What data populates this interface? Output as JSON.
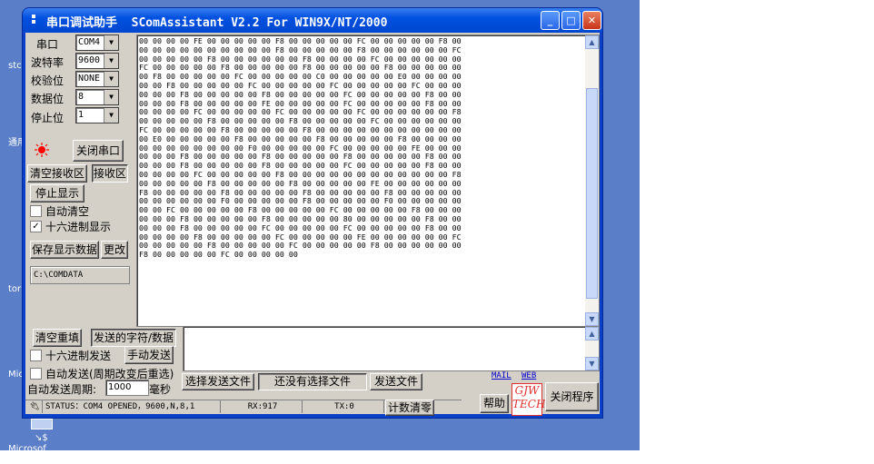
{
  "desktop": {
    "labels": [
      "stc",
      "通用",
      "tor",
      "Mic",
      "Microsof"
    ]
  },
  "window": {
    "title": "串口调试助手  SComAssistant V2.2 For WIN9X/NT/2000",
    "minimize": "_",
    "maximize": "□",
    "close": "✕"
  },
  "settings": {
    "port_label": "串口",
    "port_value": "COM4",
    "baud_label": "波特率",
    "baud_value": "9600",
    "parity_label": "校验位",
    "parity_value": "NONE",
    "databits_label": "数据位",
    "databits_value": "8",
    "stopbits_label": "停止位",
    "stopbits_value": "1"
  },
  "controls": {
    "close_port": "关闭串口",
    "clear_recv": "清空接收区",
    "recv_area": "接收区",
    "stop_display": "停止显示",
    "auto_clear": "自动清空",
    "hex_display": "十六进制显示",
    "save_display": "保存显示数据",
    "change": "更改",
    "path": "C:\\COMDATA",
    "clear_refill": "清空重填",
    "send_chars": "发送的字符/数据",
    "hex_send": "十六进制发送",
    "manual_send": "手动发送",
    "auto_send": "自动发送(周期改变后重选)",
    "auto_period_label": "自动发送周期:",
    "auto_period_value": "1000",
    "ms_label": "毫秒",
    "select_file": "选择发送文件",
    "no_file": "还没有选择文件",
    "send_file": "发送文件",
    "mail": "MAIL",
    "web": "WEB",
    "help": "帮助",
    "logo": "GJW TECH",
    "close_program": "关闭程序",
    "count_clear": "计数清零"
  },
  "status_bar": {
    "status": "STATUS：COM4 OPENED，9600,N,8,1",
    "rx": "RX:917",
    "tx": "TX:0"
  },
  "receive_lines": [
    "00 00 00 00 FE 00 00 00 00 00 F8 00 00 00 00 00 FC 00 00 00 00 00 F8 00",
    "00 00 00 00 00 00 00 00 00 00 F8 00 00 00 00 00 F8 00 00 00 00 00 00 FC",
    "00 00 00 00 00 F8 00 00 00 00 00 00 F8 00 00 00 00 FC 00 00 00 00 00 00",
    "FC 00 00 00 00 00 F8 00 00 00 00 00 F8 00 00 00 00 00 F8 00 00 00 00 00",
    "00 F8 00 00 00 00 00 FC 00 00 00 00 00 C0 00 00 00 00 00 E0 00 00 00 00",
    "00 00 F8 00 00 00 00 00 FC 00 00 00 00 00 FC 00 00 00 00 00 FC 00 00 00",
    "00 00 00 F8 00 00 00 00 00 F8 00 00 00 00 00 FC 00 00 00 00 00 F8 00 00",
    "00 00 00 F8 00 00 00 00 00 FE 00 00 00 00 00 FC 00 00 00 00 00 F8 00 00",
    "00 00 00 00 FC 00 00 00 00 00 FC 00 00 00 00 00 FC 00 00 00 00 00 00 F8",
    "00 00 00 00 00 F8 00 00 00 00 00 F8 00 00 00 00 00 FC 00 00 00 00 00 00",
    "FC 00 00 00 00 00 F8 00 00 00 00 00 F8 00 00 00 00 00 00 00 00 00 00 00",
    "00 E0 00 00 00 00 00 F8 00 00 00 00 00 F8 00 00 00 00 00 F8 00 00 00 00",
    "00 00 00 00 00 00 00 00 F0 00 00 00 00 00 FC 00 00 00 00 00 FE 00 00 00",
    "00 00 00 F8 00 00 00 00 00 F8 00 00 00 00 00 F8 00 00 00 00 00 F8 00 00",
    "00 00 00 F8 00 00 00 00 00 F8 00 00 00 00 00 FC 00 00 00 00 00 F8 00 00",
    "00 00 00 00 FC 00 00 00 00 00 F8 00 00 00 00 00 00 00 00 00 00 00 00 F8",
    "00 00 00 00 00 F8 00 00 00 00 00 F8 00 00 00 00 00 FE 00 00 00 00 00 00",
    "F8 00 00 00 00 00 F8 00 00 00 00 00 F8 00 00 00 00 00 F8 00 00 00 00 00",
    "00 00 00 00 00 00 F0 00 00 00 00 00 F8 00 00 00 00 00 F0 00 00 00 00 00",
    "00 00 FC 00 00 00 00 00 F8 00 00 00 00 00 FC 00 00 00 00 00 F8 00 00 00",
    "00 00 00 F8 00 00 00 00 00 F8 00 00 00 00 00 80 00 00 00 00 00 F8 00 00",
    "00 00 00 F8 00 00 00 00 00 FC 00 00 00 00 00 FC 00 00 00 00 00 F8 00 00",
    "00 00 00 00 F8 00 00 00 00 00 FC 00 00 00 00 00 FE 00 00 00 00 00 00 FC",
    "00 00 00 00 00 F8 00 00 00 00 00 FC 00 00 00 00 00 F8 00 00 00 00 00 00",
    "F8 00 00 00 00 00 FC 00 00 00 00 00"
  ],
  "colors": {
    "title_blue": "#0050e0",
    "face": "#d4d0c8",
    "led_red": "#ff0000"
  }
}
